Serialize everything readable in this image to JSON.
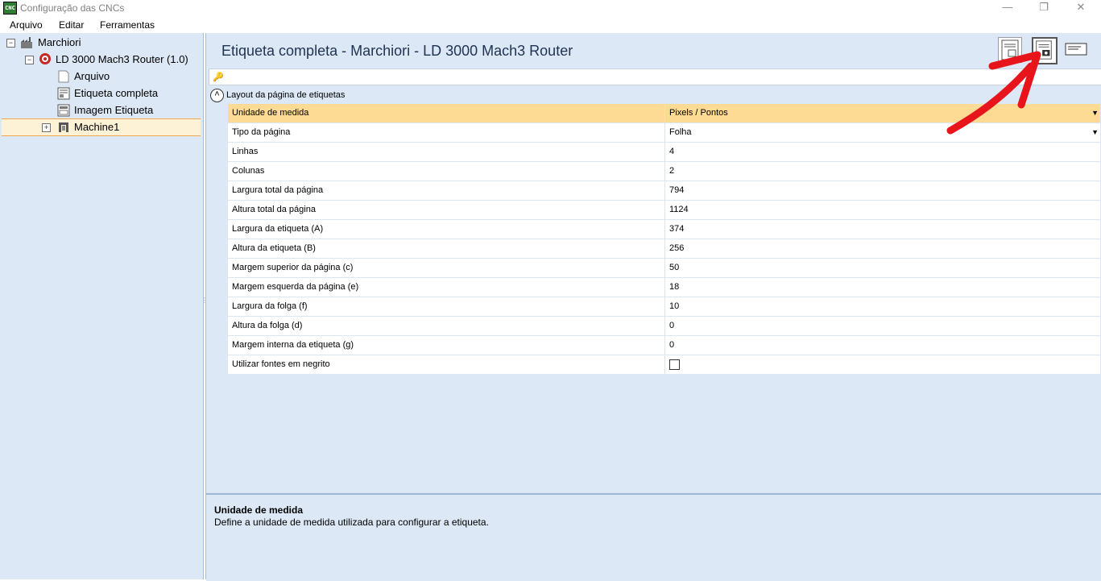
{
  "window": {
    "icon_text": "CNC",
    "title": "Configuração das CNCs",
    "min_glyph": "—",
    "restore_glyph": "❐",
    "close_glyph": "✕"
  },
  "menu": [
    "Arquivo",
    "Editar",
    "Ferramentas"
  ],
  "tree": {
    "root": "Marchiori",
    "machine": "LD 3000 Mach3 Router (1.0)",
    "items": [
      "Arquivo",
      "Etiqueta completa",
      "Imagem Etiqueta"
    ],
    "child": "Machine1",
    "selected": "Etiqueta completa"
  },
  "header": {
    "title": "Etiqueta completa - Marchiori - LD 3000 Mach3 Router"
  },
  "grid": {
    "group_label": "Layout da página de etiquetas",
    "rows": [
      {
        "name": "Unidade de medida",
        "value": "Pixels / Pontos",
        "dropdown": true,
        "selected": true
      },
      {
        "name": "Tipo da página",
        "value": "Folha",
        "dropdown": true
      },
      {
        "name": "Linhas",
        "value": "4"
      },
      {
        "name": "Colunas",
        "value": "2"
      },
      {
        "name": "Largura total da página",
        "value": "794"
      },
      {
        "name": "Altura total da página",
        "value": "1124"
      },
      {
        "name": "Largura da etiqueta (A)",
        "value": "374"
      },
      {
        "name": "Altura da etiqueta (B)",
        "value": "256"
      },
      {
        "name": "Margem superior da página (c)",
        "value": "50"
      },
      {
        "name": "Margem esquerda da página (e)",
        "value": "18"
      },
      {
        "name": "Largura da folga (f)",
        "value": "10"
      },
      {
        "name": "Altura da folga (d)",
        "value": "0"
      },
      {
        "name": "Margem interna da etiqueta (g)",
        "value": "0"
      },
      {
        "name": "Utilizar fontes em negrito",
        "value": "",
        "checkbox": true,
        "checked": false
      }
    ]
  },
  "description": {
    "title": "Unidade de medida",
    "text": "Define a unidade de medida utilizada para configurar a etiqueta."
  },
  "colors": {
    "panel_bg": "#dce8f6",
    "selected_row": "#fddb94",
    "tree_selected": "#fdf1d6",
    "annotation_arrow": "#e8141c"
  }
}
